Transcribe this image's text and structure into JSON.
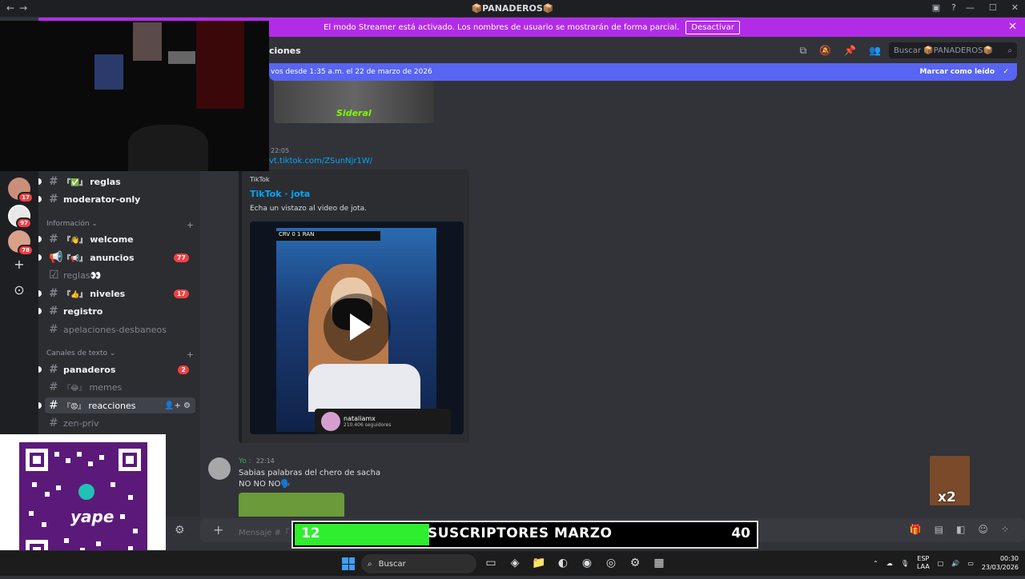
{
  "window": {
    "title": "📦PANADEROS📦",
    "nav_back": "←",
    "nav_forward": "→",
    "minimize": "—",
    "maximize": "☐",
    "close": "✕"
  },
  "streamer_banner": {
    "text": "El modo Streamer está activado. Los nombres de usuario se mostrarán de forma parcial.",
    "button": "Desactivar",
    "close": "✕"
  },
  "rail": {
    "badges": [
      "17",
      "97",
      "78"
    ],
    "add_icon": "+",
    "explore_icon": "⊙"
  },
  "sidebar": {
    "channels_top": [
      {
        "prefix": "『✅』",
        "name": "reglas"
      },
      {
        "prefix": "",
        "name": "moderator-only"
      }
    ],
    "cat_info": "Información",
    "info_channels": [
      {
        "prefix": "『👋』",
        "name": "welcome",
        "badge": ""
      },
      {
        "prefix": "『📢』",
        "name": "anuncios",
        "badge": "77"
      },
      {
        "prefix": "",
        "name": "reglas👀",
        "badge": ""
      },
      {
        "prefix": "『👍』",
        "name": "niveles",
        "badge": "17"
      },
      {
        "prefix": "",
        "name": "registro",
        "badge": ""
      },
      {
        "prefix": "",
        "name": "apelaciones-desbaneos",
        "badge": ""
      }
    ],
    "cat_text": "Canales de texto",
    "text_channels": [
      {
        "prefix": "",
        "name": "panaderos",
        "badge": "2"
      },
      {
        "prefix": "『😂』",
        "name": "memes",
        "badge": ""
      },
      {
        "prefix": "『😡』",
        "name": "reacciones",
        "badge": ""
      },
      {
        "prefix": "",
        "name": "zen-priv",
        "badge": ""
      }
    ]
  },
  "header": {
    "channel_fragment": "ciones",
    "search_placeholder": "Buscar 📦PANADEROS📦"
  },
  "new_messages_bar": {
    "text": "vos desde 1:35 a.m. el 22 de marzo de 2026",
    "action": "Marcar como leído"
  },
  "messages": {
    "top_image_caption": "Sideral",
    "time1": "22:05",
    "link": "vt.tiktok.com/ZSunNjr1W/",
    "embed": {
      "provider": "TikTok",
      "title": "TikTok · jota",
      "description": "Echa un vistazo al video de jota.",
      "scoreboard": "CRV 0 1 RAN",
      "account": "nataliamx",
      "followers": "210.406 seguidores"
    },
    "msg2": {
      "user": "Yo :",
      "time": "22:14",
      "line1": "Sabias palabras del chero de sacha",
      "line2": "NO NO NO🗣️"
    }
  },
  "input": {
    "placeholder": "Mensaje #『"
  },
  "overlay": {
    "subs_current": "12",
    "subs_label": "SUSCRIPTORES MARZO",
    "subs_goal": "40",
    "meme_label": "x2",
    "subs_progress": 0.3
  },
  "taskbar": {
    "search": "Buscar",
    "lang": "ESP\nLAA",
    "time": "00:30",
    "date": "23/03/2026"
  }
}
